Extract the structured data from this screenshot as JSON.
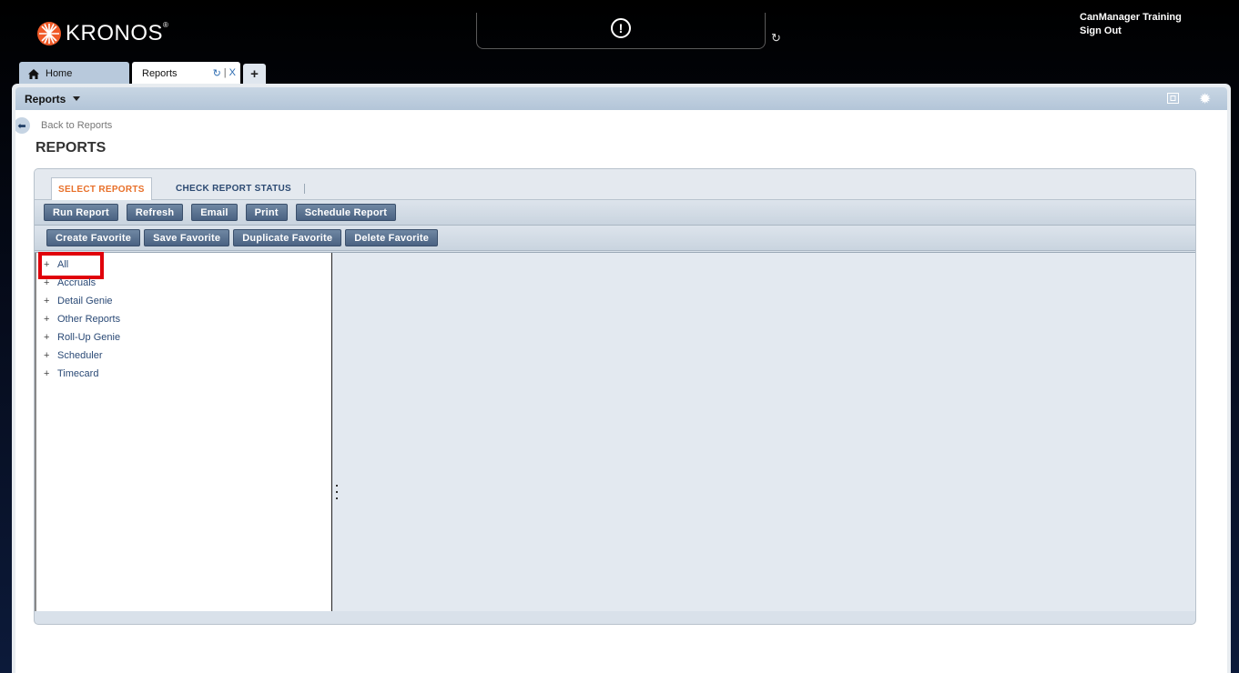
{
  "brand": {
    "name": "KRONOS",
    "mark": "®"
  },
  "alert": {
    "icon": "exclamation-circle-icon"
  },
  "user": {
    "name": "CanManager Training",
    "sign_out": "Sign Out"
  },
  "tabs": [
    {
      "label": "Home",
      "icon": "home-icon"
    },
    {
      "label": "Reports",
      "refresh": "↻",
      "divider": "|",
      "close": "X"
    }
  ],
  "tab_add": "+",
  "panel": {
    "title": "Reports"
  },
  "back_link": "Back to Reports",
  "page_title": "REPORTS",
  "subtabs": {
    "select": "SELECT REPORTS",
    "check": "CHECK REPORT STATUS"
  },
  "toolbar1": [
    "Run Report",
    "Refresh",
    "Email",
    "Print",
    "Schedule Report"
  ],
  "toolbar2": [
    "Create Favorite",
    "Save Favorite",
    "Duplicate Favorite",
    "Delete Favorite"
  ],
  "tree": [
    "All",
    "Accruals",
    "Detail Genie",
    "Other Reports",
    "Roll-Up Genie",
    "Scheduler",
    "Timecard"
  ],
  "tree_expander": "+",
  "colors": {
    "highlight": "#e0000b",
    "accent_orange": "#e8702a",
    "link_blue": "#2b4a76"
  }
}
